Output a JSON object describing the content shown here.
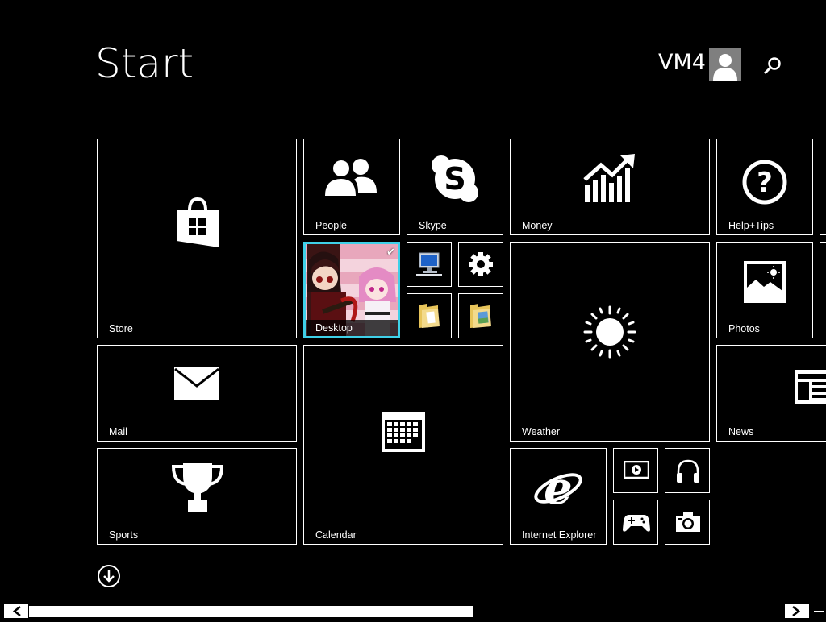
{
  "header": {
    "title": "Start",
    "user_name": "VM4"
  },
  "tiles": {
    "store": "Store",
    "people": "People",
    "skype": "Skype",
    "money": "Money",
    "help_tips": "Help+Tips",
    "desktop": "Desktop",
    "photos": "Photos",
    "mail": "Mail",
    "weather": "Weather",
    "news": "News",
    "calendar": "Calendar",
    "sports": "Sports",
    "internet_explorer": "Internet Explorer"
  },
  "icons": {
    "store": "store-bag-icon",
    "people": "people-icon",
    "skype": "skype-icon",
    "money": "chart-up-icon",
    "help": "question-icon",
    "photos": "picture-icon",
    "mail": "envelope-icon",
    "weather": "sun-icon",
    "news": "newspaper-icon",
    "calendar": "calendar-icon",
    "sports": "trophy-icon",
    "ie": "internet-explorer-icon",
    "computer": "computer-icon",
    "settings": "gear-icon",
    "documents": "folder-documents-icon",
    "pictures": "folder-pictures-icon",
    "video": "video-icon",
    "music": "headphones-icon",
    "games": "gamepad-icon",
    "camera": "camera-icon",
    "all_apps": "arrow-down-circle-icon"
  },
  "colors": {
    "background": "#000000",
    "foreground": "#ffffff",
    "selection": "#3fd0e8"
  }
}
